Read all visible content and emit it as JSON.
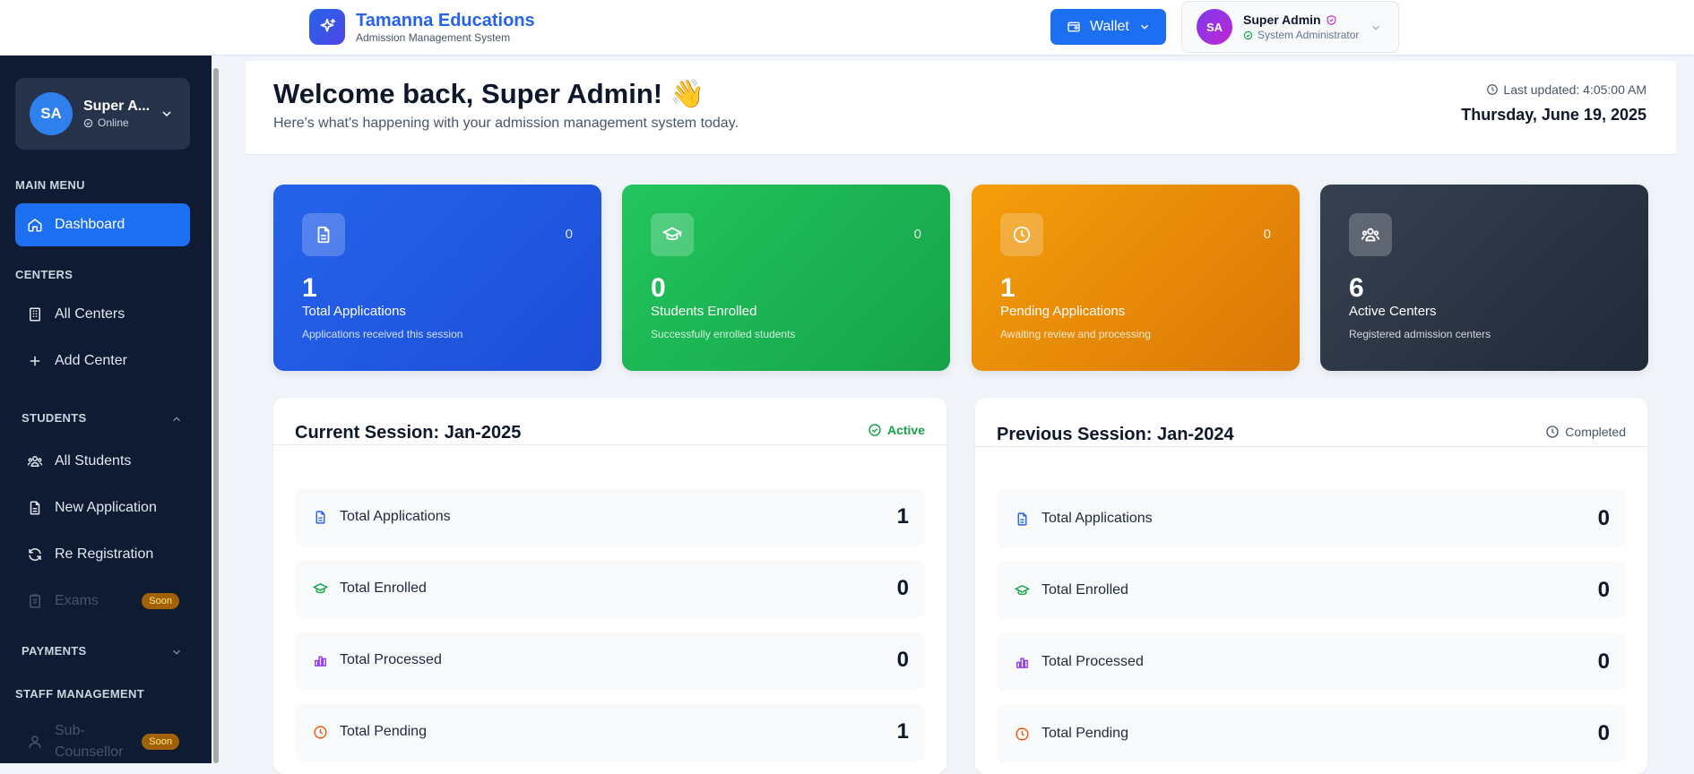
{
  "header": {
    "brand_name": "Tamanna Educations",
    "brand_sub": "Admission Management System",
    "wallet_label": "Wallet",
    "user_initials": "SA",
    "user_name": "Super Admin",
    "user_role": "System Administrator"
  },
  "sidebar": {
    "profile_initials": "SA",
    "profile_name": "Super A...",
    "profile_status": "Online",
    "main_menu_title": "MAIN MENU",
    "dashboard": "Dashboard",
    "centers_title": "CENTERS",
    "all_centers": "All Centers",
    "add_center": "Add Center",
    "students_title": "STUDENTS",
    "all_students": "All Students",
    "new_application": "New Application",
    "re_registration": "Re Registration",
    "exams": "Exams",
    "soon": "Soon",
    "payments_title": "PAYMENTS",
    "staff_title": "STAFF MANAGEMENT",
    "sub_counsellor": "Sub-Counsellor"
  },
  "welcome": {
    "title": "Welcome back, Super Admin! 👋",
    "subtitle": "Here's what's happening with your admission management system today.",
    "last_updated": "Last updated: 4:05:00 AM",
    "date": "Thursday, June 19, 2025"
  },
  "stats": [
    {
      "corner": "0",
      "value": "1",
      "label": "Total Applications",
      "desc": "Applications received this session",
      "icon": "document-icon"
    },
    {
      "corner": "0",
      "value": "0",
      "label": "Students Enrolled",
      "desc": "Successfully enrolled students",
      "icon": "graduation-cap-icon"
    },
    {
      "corner": "0",
      "value": "1",
      "label": "Pending Applications",
      "desc": "Awaiting review and processing",
      "icon": "clock-icon"
    },
    {
      "corner": "",
      "value": "6",
      "label": "Active Centers",
      "desc": "Registered admission centers",
      "icon": "users-icon"
    }
  ],
  "current_session": {
    "title": "Current Session: Jan-2025",
    "status": "Active",
    "rows": [
      {
        "label": "Total Applications",
        "value": "1"
      },
      {
        "label": "Total Enrolled",
        "value": "0"
      },
      {
        "label": "Total Processed",
        "value": "0"
      },
      {
        "label": "Total Pending",
        "value": "1"
      }
    ]
  },
  "previous_session": {
    "title": "Previous Session: Jan-2024",
    "status": "Completed",
    "rows": [
      {
        "label": "Total Applications",
        "value": "0"
      },
      {
        "label": "Total Enrolled",
        "value": "0"
      },
      {
        "label": "Total Processed",
        "value": "0"
      },
      {
        "label": "Total Pending",
        "value": "0"
      }
    ]
  },
  "colors": {
    "primary": "#1d6ff2",
    "sidebar_bg": "#0f1a33",
    "success": "#16a34a",
    "warning": "#d97706",
    "purple": "#9333ea"
  }
}
